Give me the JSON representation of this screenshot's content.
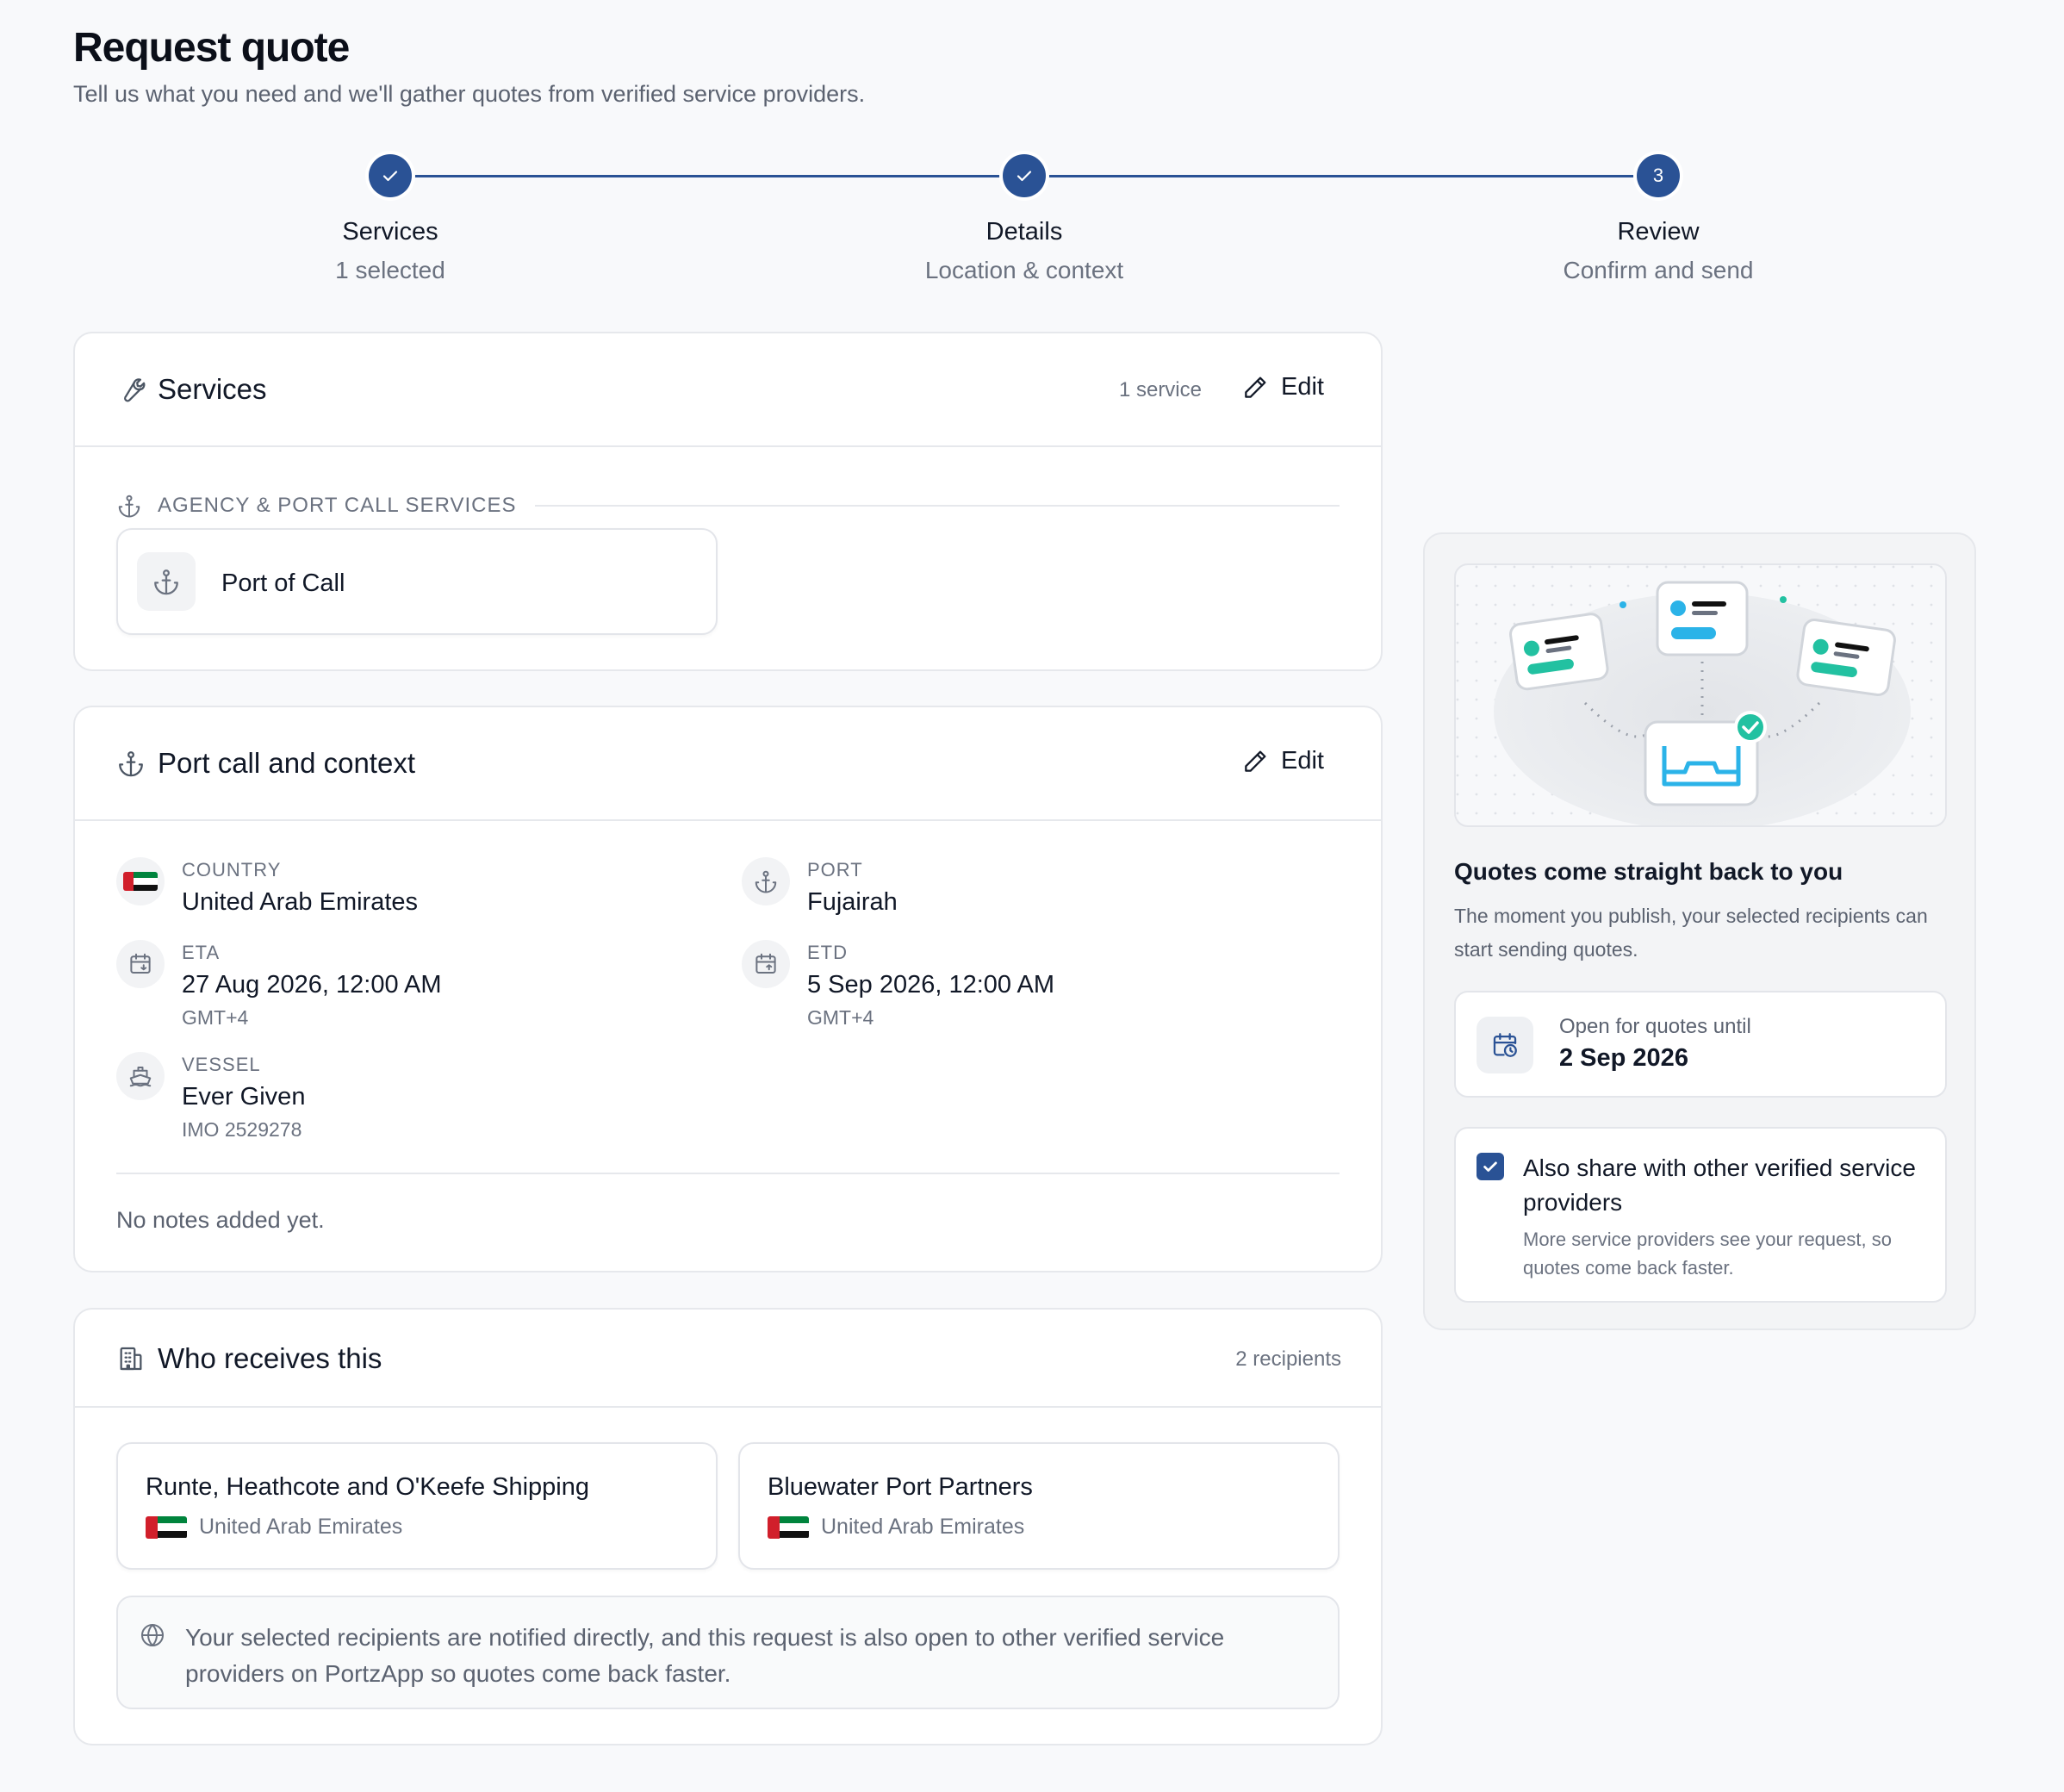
{
  "page": {
    "title": "Request quote",
    "subtitle": "Tell us what you need and we'll gather quotes from verified service providers."
  },
  "stepper": {
    "steps": [
      {
        "label": "Services",
        "sub": "1 selected",
        "state": "done"
      },
      {
        "label": "Details",
        "sub": "Location & context",
        "state": "done"
      },
      {
        "label": "Review",
        "sub": "Confirm and send",
        "state": "current",
        "number": "3"
      }
    ]
  },
  "services_card": {
    "title": "Services",
    "count": "1 service",
    "edit_label": "Edit",
    "section_label": "AGENCY & PORT CALL SERVICES",
    "items": [
      {
        "label": "Port of Call",
        "icon": "anchor-icon"
      }
    ]
  },
  "portcall_card": {
    "title": "Port call and context",
    "edit_label": "Edit",
    "country": {
      "label": "COUNTRY",
      "value": "United Arab Emirates"
    },
    "port": {
      "label": "PORT",
      "value": "Fujairah"
    },
    "eta": {
      "label": "ETA",
      "value": "27 Aug 2026, 12:00 AM",
      "tz": "GMT+4"
    },
    "etd": {
      "label": "ETD",
      "value": "5 Sep 2026, 12:00 AM",
      "tz": "GMT+4"
    },
    "vessel": {
      "label": "VESSEL",
      "value": "Ever Given",
      "imo": "IMO 2529278"
    },
    "notes": "No notes added yet."
  },
  "recipients_card": {
    "title": "Who receives this",
    "count": "2 recipients",
    "recipients": [
      {
        "name": "Runte, Heathcote and O'Keefe Shipping",
        "country": "United Arab Emirates"
      },
      {
        "name": "Bluewater Port Partners",
        "country": "United Arab Emirates"
      }
    ],
    "info": "Your selected recipients are notified directly, and this request is also open to other verified service providers on PortzApp so quotes come back faster."
  },
  "side_panel": {
    "title": "Quotes come straight back to you",
    "description": "The moment you publish, your selected recipients can start sending quotes.",
    "open_label": "Open for quotes until",
    "open_date": "2 Sep 2026",
    "share_title": "Also share with other verified service providers",
    "share_desc": "More service providers see your request, so quotes come back faster.",
    "share_checked": true
  },
  "colors": {
    "primary": "#2a5295",
    "accent_teal": "#22c1a1",
    "accent_blue": "#2bb3e8",
    "uae_red": "#d11f2b",
    "uae_green": "#00843d"
  }
}
